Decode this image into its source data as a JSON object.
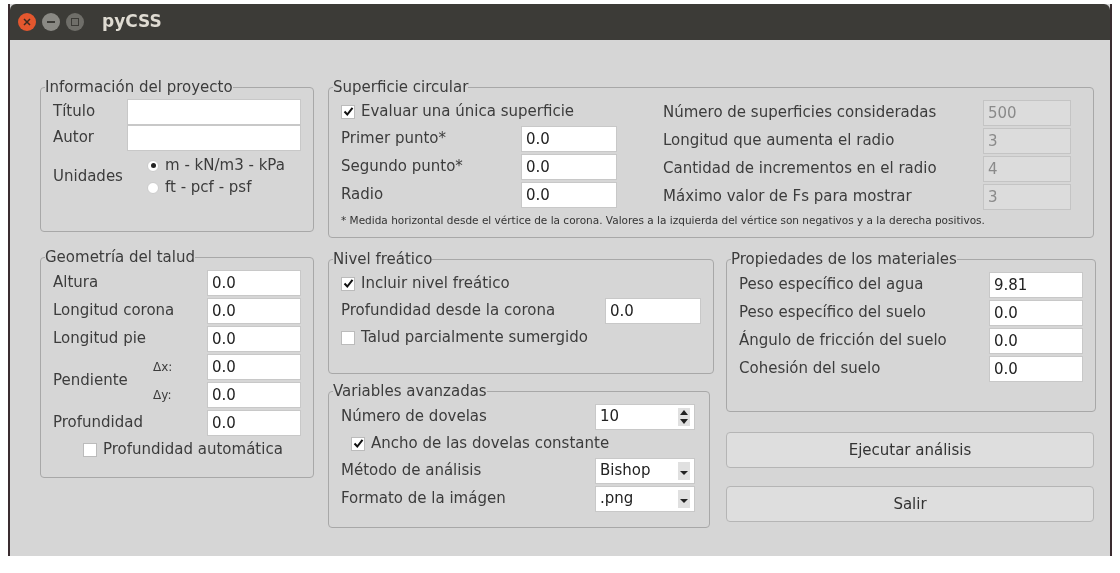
{
  "window": {
    "title": "pyCSS"
  },
  "project_info": {
    "title": "Información del proyecto",
    "fields": [
      {
        "label": "Título"
      },
      {
        "label": "Autor"
      }
    ],
    "units": {
      "label": "Unidades",
      "options": [
        {
          "label": "m - kN/m3 - kPa",
          "selected": true
        },
        {
          "label": "ft - pcf - psf",
          "selected": false
        }
      ]
    }
  },
  "slope_geometry": {
    "title": "Geometría del talud",
    "rows": [
      {
        "kind": "field",
        "label": "Altura",
        "value": "0.0"
      },
      {
        "kind": "field",
        "label": "Longitud corona",
        "value": "0.0"
      },
      {
        "kind": "field",
        "label": "Longitud pie",
        "value": "0.0"
      },
      {
        "kind": "pair",
        "label": "Pendiente",
        "items": [
          {
            "label": "Δx:",
            "value": "0.0"
          },
          {
            "label": "Δy:",
            "value": "0.0"
          }
        ]
      },
      {
        "kind": "field",
        "label": "Profundidad",
        "value": "0.0"
      },
      {
        "kind": "check",
        "label": "Profundidad automática",
        "checked": false
      }
    ]
  },
  "circular_surface": {
    "title": "Superficie circular",
    "left": [
      {
        "kind": "check",
        "label": "Evaluar una única superficie",
        "checked": true
      },
      {
        "kind": "field",
        "label": "Primer punto*",
        "value": "0.0"
      },
      {
        "kind": "field",
        "label": "Segundo punto*",
        "value": "0.0"
      },
      {
        "kind": "field",
        "label": "Radio",
        "value": "0.0"
      }
    ],
    "right": [
      {
        "label": "Número de superficies consideradas",
        "value": "500",
        "disabled": true
      },
      {
        "label": "Longitud que aumenta el radio",
        "value": "3",
        "disabled": true
      },
      {
        "label": "Cantidad de incrementos en el radio",
        "value": "4",
        "disabled": true
      },
      {
        "label": "Máximo valor de Fs para mostrar",
        "value": "3",
        "disabled": true
      }
    ],
    "note": "* Medida horizontal desde el vértice de la corona. Valores a la izquierda del vértice son negativos y a la derecha positivos."
  },
  "water_table": {
    "title": "Nivel freático",
    "rows": [
      {
        "kind": "check",
        "label": "Incluir nivel freático",
        "checked": true
      },
      {
        "kind": "field",
        "label": "Profundidad desde la corona",
        "value": "0.0"
      },
      {
        "kind": "check",
        "label": "Talud parcialmente sumergido",
        "checked": false
      }
    ]
  },
  "advanced": {
    "title": "Variables avanzadas",
    "rows": [
      {
        "kind": "spin",
        "label": "Número de dovelas",
        "value": "10"
      },
      {
        "kind": "check",
        "label": "Ancho de las dovelas constante",
        "checked": true
      },
      {
        "kind": "combo",
        "label": "Método de análisis",
        "value": "Bishop"
      },
      {
        "kind": "combo",
        "label": "Formato de la imágen",
        "value": ".png"
      }
    ]
  },
  "materials": {
    "title": "Propiedades de los materiales",
    "fields": [
      {
        "label": "Peso específico del agua",
        "value": "9.81"
      },
      {
        "label": "Peso específico del suelo",
        "value": "0.0"
      },
      {
        "label": "Ángulo de fricción del suelo",
        "value": "0.0"
      },
      {
        "label": "Cohesión del suelo",
        "value": "0.0"
      }
    ]
  },
  "buttons": [
    "Ejecutar análisis",
    "Salir"
  ]
}
